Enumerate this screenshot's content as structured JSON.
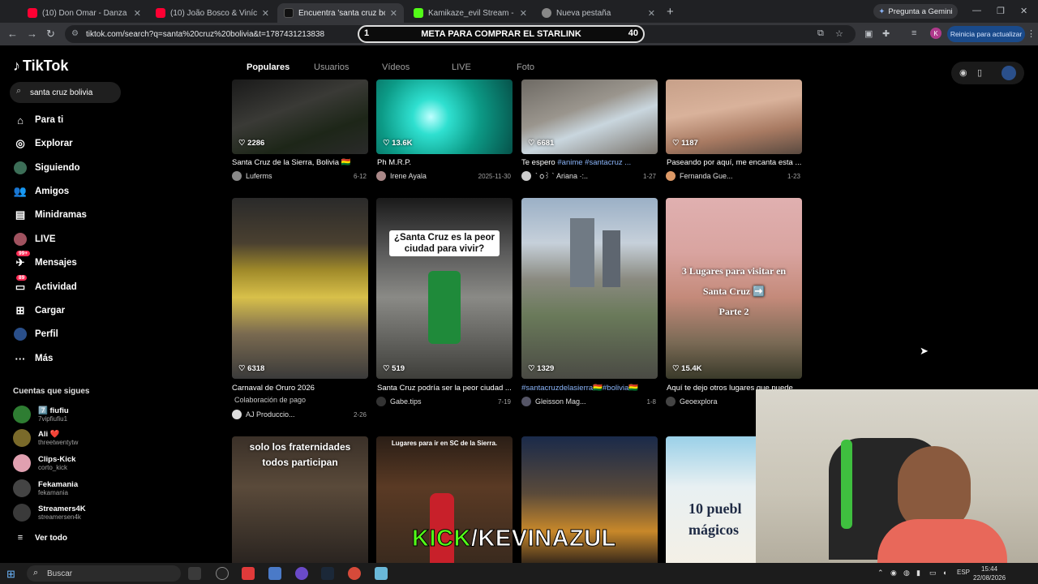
{
  "browser": {
    "tabs": [
      {
        "title": "(10) Don Omar - Danza Kuduro",
        "favicon_color": "#ff0033"
      },
      {
        "title": "(10) João Bosco & Vinícius - Ch",
        "favicon_color": "#ff0033"
      },
      {
        "title": "Encuentra 'santa cruz bolivia' e",
        "favicon_color": "#111111"
      },
      {
        "title": "Kamikaze_evil Stream - Watch L",
        "favicon_color": "#53fc18"
      },
      {
        "title": "Nueva pestaña",
        "favicon_color": "#888888"
      }
    ],
    "gemini_label": "Pregunta a Gemini",
    "url": "tiktok.com/search?q=santa%20cruz%20bolivia&t=1787431213838",
    "profile_letter": "K",
    "update_label": "Reinicia para actualizar"
  },
  "overlay": {
    "meta_text": "META PARA COMPRAR EL STARLINK",
    "meta_left": "1",
    "meta_right": "40",
    "kick_green": "KICK",
    "kick_white": "/KEVINAZUL"
  },
  "sidebar": {
    "logo": "TikTok",
    "search_value": "santa cruz bolivia",
    "nav": [
      {
        "label": "Para ti",
        "icon": "home-icon"
      },
      {
        "label": "Explorar",
        "icon": "compass-icon"
      },
      {
        "label": "Siguiendo",
        "icon": "following-icon"
      },
      {
        "label": "Amigos",
        "icon": "friends-icon"
      },
      {
        "label": "Minidramas",
        "icon": "minidramas-icon"
      },
      {
        "label": "LIVE",
        "icon": "live-icon"
      },
      {
        "label": "Mensajes",
        "icon": "messages-icon",
        "badge": "99+"
      },
      {
        "label": "Actividad",
        "icon": "activity-icon",
        "badge": "89"
      },
      {
        "label": "Cargar",
        "icon": "upload-icon"
      },
      {
        "label": "Perfil",
        "icon": "profile-icon"
      },
      {
        "label": "Más",
        "icon": "more-icon"
      }
    ],
    "following_title": "Cuentas que sigues",
    "following": [
      {
        "name": "7️⃣ fiufiu",
        "handle": "7vipfiufiu1",
        "color": "#2e7d32"
      },
      {
        "name": "Ali ❤️",
        "handle": "threetwentytw",
        "color": "#7a6a2a"
      },
      {
        "name": "Clips-Kick",
        "handle": "corto_kick",
        "color": "#e0a0b0"
      },
      {
        "name": "Fekamania",
        "handle": "fekamania",
        "color": "#444444"
      },
      {
        "name": "Streamers4K",
        "handle": "streamersen4k",
        "color": "#3a3a3a"
      }
    ],
    "see_all": "Ver todo"
  },
  "content_tabs": [
    "Populares",
    "Usuarios",
    "Vídeos",
    "LIVE",
    "Foto"
  ],
  "videos_row1": [
    {
      "likes": "2286",
      "desc": "Santa Cruz de la Sierra, Bolivia 🇧🇴",
      "author": "Luferms",
      "date": "6-12"
    },
    {
      "likes": "13.6K",
      "desc": "Ph M.R.P.",
      "author": "Irene Ayala",
      "date": "2025-11-30"
    },
    {
      "likes": "6681",
      "desc_plain": "Te espero",
      "desc_hash": " #anime #santacruz ...",
      "author": "` ѻ꒱ ` Ariana ·:..",
      "date": "1-27"
    },
    {
      "likes": "1187",
      "desc": "Paseando por aquí, me encanta esta ...",
      "author": "Fernanda Gue...",
      "date": "1-23"
    }
  ],
  "videos_row2": [
    {
      "likes": "6318",
      "desc": "Carnaval de Oruro 2026",
      "sub": "Colaboración de pago",
      "author": "AJ Produccio...",
      "date": "2-26"
    },
    {
      "likes": "519",
      "desc": "Santa Cruz podría ser la peor ciudad ...",
      "author": "Gabe.tips",
      "date": "7-19",
      "overlay": "¿Santa Cruz es la peor ciudad para vivir?"
    },
    {
      "likes": "1329",
      "desc_hash": "#santacruzdelasierra🇧🇴#bolivia🇧🇴",
      "author": "Gleisson Mag...",
      "date": "1-8"
    },
    {
      "likes": "15.4K",
      "desc": "Aquí te dejo otros lugares que puede...",
      "author": "Geoexplora",
      "date": "",
      "overlay_lines": [
        "3 Lugares para visitar en",
        "Santa Cruz ➡️",
        "Parte 2"
      ]
    }
  ],
  "videos_row3": [
    {
      "overlay_lines": [
        "solo los fraternidades",
        "todos participan"
      ]
    },
    {
      "overlay": "Lugares para ir en SC de la Sierra."
    },
    {},
    {
      "overlay_lines": [
        "10 puebl",
        "mágicos"
      ]
    }
  ],
  "taskbar": {
    "search_label": "Buscar",
    "lang": "ESP",
    "time": "15:44",
    "date": "22/08/2026"
  }
}
